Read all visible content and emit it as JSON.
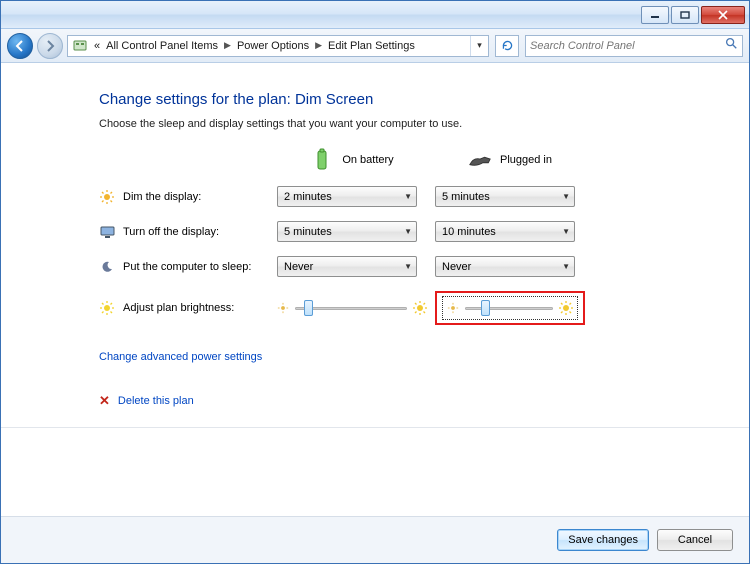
{
  "titlebar": {
    "min": "",
    "max": "",
    "close": ""
  },
  "breadcrumb": {
    "back_icon": "back-icon",
    "items": [
      "All Control Panel Items",
      "Power Options",
      "Edit Plan Settings"
    ]
  },
  "search": {
    "placeholder": "Search Control Panel"
  },
  "page": {
    "heading": "Change settings for the plan: Dim Screen",
    "subhead": "Choose the sleep and display settings that you want your computer to use."
  },
  "columns": {
    "battery": "On battery",
    "plugged": "Plugged in"
  },
  "rows": {
    "dim": {
      "label": "Dim the display:",
      "battery": "2 minutes",
      "plugged": "5 minutes"
    },
    "off": {
      "label": "Turn off the display:",
      "battery": "5 minutes",
      "plugged": "10 minutes"
    },
    "sleep": {
      "label": "Put the computer to sleep:",
      "battery": "Never",
      "plugged": "Never"
    },
    "bright": {
      "label": "Adjust plan brightness:"
    }
  },
  "brightness": {
    "battery_pos_pct": 8,
    "plugged_pos_pct": 18
  },
  "links": {
    "advanced": "Change advanced power settings",
    "delete": "Delete this plan"
  },
  "footer": {
    "save": "Save changes",
    "cancel": "Cancel"
  },
  "colors": {
    "accent": "#0046c3",
    "danger": "#c2261a",
    "highlight": "#e41b1b"
  }
}
